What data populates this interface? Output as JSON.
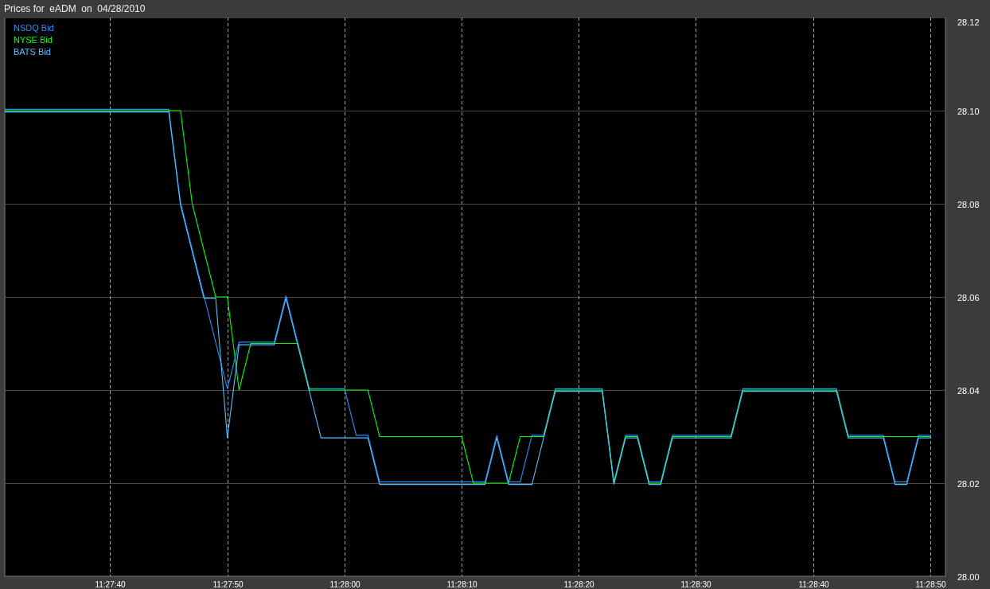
{
  "window": {
    "title": "Prices for  eADM  on  04/28/2010"
  },
  "chart_data": {
    "type": "line",
    "categories": [
      null,
      null,
      null,
      null,
      null,
      null,
      null,
      null,
      null,
      "11:27:40",
      null,
      null,
      null,
      null,
      null,
      null,
      null,
      null,
      null,
      "11:27:50",
      null,
      null,
      null,
      null,
      null,
      null,
      null,
      null,
      null,
      "11:28:00",
      null,
      null,
      null,
      null,
      null,
      null,
      null,
      null,
      null,
      "11:28:10",
      null,
      null,
      null,
      null,
      null,
      null,
      null,
      null,
      null,
      "11:28:20",
      null,
      null,
      null,
      null,
      null,
      null,
      null,
      null,
      null,
      "11:28:30",
      null,
      null,
      null,
      null,
      null,
      null,
      null,
      null,
      null,
      "11:28:40",
      null,
      null,
      null,
      null,
      null,
      null,
      null,
      null,
      null,
      "11:28:50"
    ],
    "series": [
      {
        "name": "NSDQ Bid",
        "color": "#1e90ff",
        "values": [
          28.1,
          28.1,
          28.1,
          28.1,
          28.1,
          28.1,
          28.1,
          28.1,
          28.1,
          28.1,
          28.1,
          28.1,
          28.1,
          28.1,
          28.1,
          28.08,
          28.07,
          28.06,
          28.05,
          28.04,
          28.05,
          28.05,
          28.05,
          28.05,
          28.06,
          28.05,
          28.04,
          28.04,
          28.04,
          28.04,
          28.03,
          28.03,
          28.02,
          28.02,
          28.02,
          28.02,
          28.02,
          28.02,
          28.02,
          28.02,
          28.02,
          28.02,
          28.03,
          28.02,
          28.02,
          28.03,
          28.03,
          28.04,
          28.04,
          28.04,
          28.04,
          28.04,
          28.02,
          28.03,
          28.03,
          28.02,
          28.02,
          28.03,
          28.03,
          28.03,
          28.03,
          28.03,
          28.03,
          28.04,
          28.04,
          28.04,
          28.04,
          28.04,
          28.04,
          28.04,
          28.04,
          28.04,
          28.03,
          28.03,
          28.03,
          28.03,
          28.02,
          28.02,
          28.03,
          28.03
        ]
      },
      {
        "name": "NYSE Bid",
        "color": "#00ff00",
        "values": [
          28.1,
          28.1,
          28.1,
          28.1,
          28.1,
          28.1,
          28.1,
          28.1,
          28.1,
          28.1,
          28.1,
          28.1,
          28.1,
          28.1,
          28.1,
          28.1,
          28.08,
          28.07,
          28.06,
          28.06,
          28.04,
          28.05,
          28.05,
          28.05,
          28.05,
          28.05,
          28.04,
          28.04,
          28.04,
          28.04,
          28.04,
          28.04,
          28.03,
          28.03,
          28.03,
          28.03,
          28.03,
          28.03,
          28.03,
          28.03,
          28.02,
          28.02,
          28.02,
          28.02,
          28.03,
          28.03,
          28.03,
          28.04,
          28.04,
          28.04,
          28.04,
          28.04,
          28.02,
          28.03,
          28.03,
          28.02,
          28.02,
          28.03,
          28.03,
          28.03,
          28.03,
          28.03,
          28.03,
          28.04,
          28.04,
          28.04,
          28.04,
          28.04,
          28.04,
          28.04,
          28.04,
          28.04,
          28.03,
          28.03,
          28.03,
          28.03,
          28.03,
          28.03,
          28.03,
          28.03
        ]
      },
      {
        "name": "BATS Bid",
        "color": "#55bfff",
        "values": [
          28.1,
          28.1,
          28.1,
          28.1,
          28.1,
          28.1,
          28.1,
          28.1,
          28.1,
          28.1,
          28.1,
          28.1,
          28.1,
          28.1,
          28.1,
          28.08,
          28.07,
          28.06,
          28.06,
          28.03,
          28.05,
          28.05,
          28.05,
          28.05,
          28.06,
          28.05,
          28.04,
          28.03,
          28.03,
          28.03,
          28.03,
          28.03,
          28.02,
          28.02,
          28.02,
          28.02,
          28.02,
          28.02,
          28.02,
          28.02,
          28.02,
          28.02,
          28.03,
          28.02,
          28.02,
          28.02,
          28.03,
          28.04,
          28.04,
          28.04,
          28.04,
          28.04,
          28.02,
          28.03,
          28.03,
          28.02,
          28.02,
          28.03,
          28.03,
          28.03,
          28.03,
          28.03,
          28.03,
          28.04,
          28.04,
          28.04,
          28.04,
          28.04,
          28.04,
          28.04,
          28.04,
          28.04,
          28.03,
          28.03,
          28.03,
          28.03,
          28.02,
          28.02,
          28.03,
          28.03
        ]
      }
    ],
    "ylim": [
      28.0,
      28.12
    ],
    "grid": true,
    "yticks": [
      {
        "value": 28.0,
        "label": "28.00"
      },
      {
        "value": 28.02,
        "label": "28.02"
      },
      {
        "value": 28.04,
        "label": "28.04"
      },
      {
        "value": 28.06,
        "label": "28.06"
      },
      {
        "value": 28.08,
        "label": "28.08"
      },
      {
        "value": 28.1,
        "label": "28.10"
      },
      {
        "value": 28.12,
        "label": "28.12"
      }
    ]
  }
}
